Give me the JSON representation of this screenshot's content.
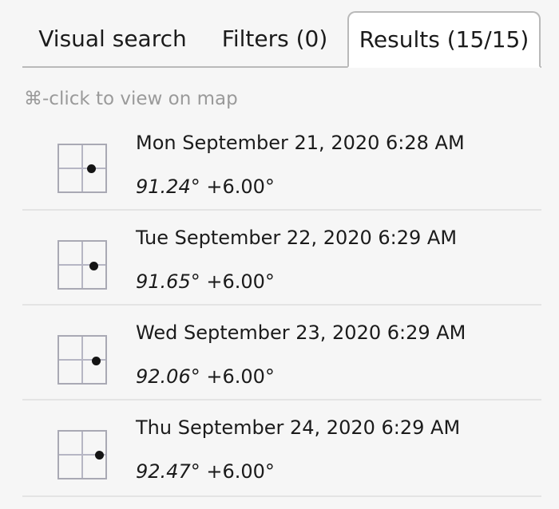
{
  "tabs": [
    {
      "label": "Visual search",
      "active": false
    },
    {
      "label": "Filters (0)",
      "active": false
    },
    {
      "label": "Results (15/15)",
      "active": true
    }
  ],
  "hint": "⌘-click to view on map",
  "results": [
    {
      "datetime": "Mon September 21, 2020 6:28 AM",
      "azimuth": "91.24°",
      "altitude": "+6.00°"
    },
    {
      "datetime": "Tue September 22, 2020 6:29 AM",
      "azimuth": "91.65°",
      "altitude": "+6.00°"
    },
    {
      "datetime": "Wed September 23, 2020 6:29 AM",
      "azimuth": "92.06°",
      "altitude": "+6.00°"
    },
    {
      "datetime": "Thu September 24, 2020 6:29 AM",
      "azimuth": "92.47°",
      "altitude": "+6.00°"
    }
  ]
}
